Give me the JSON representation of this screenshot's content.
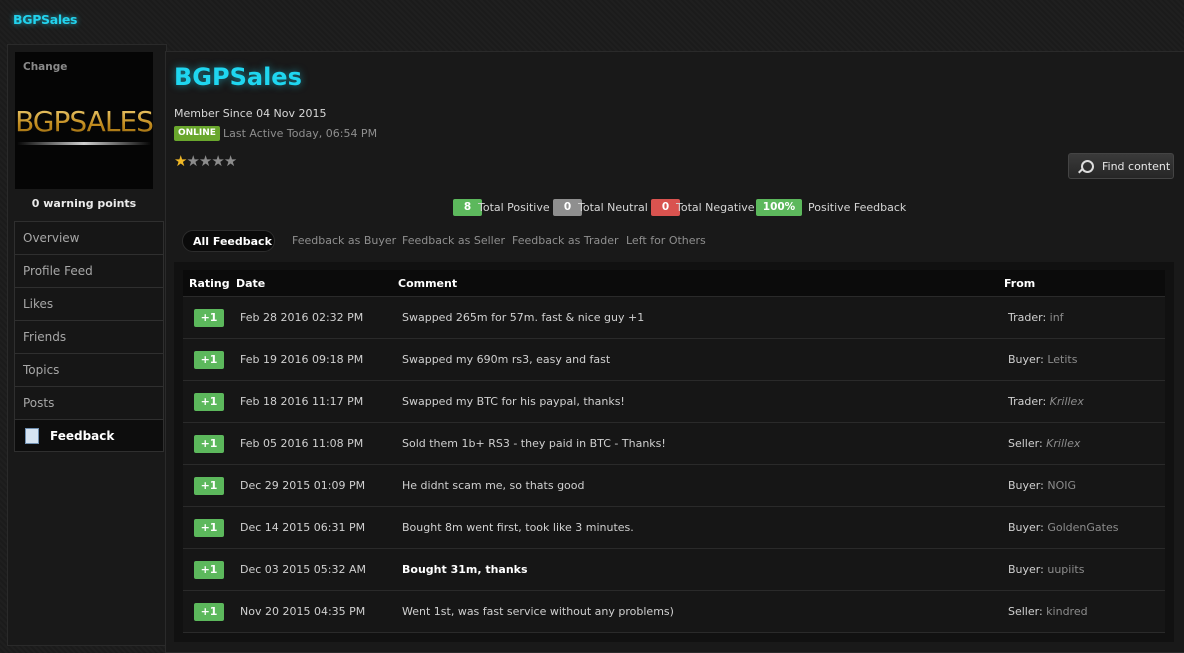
{
  "site": {
    "title": "BGPSales"
  },
  "profile": {
    "avatar_change": "Change",
    "avatar_logo": "BGPSALES",
    "warning_points": "0 warning points",
    "name": "BGPSales",
    "member_since": "Member Since 04 Nov 2015",
    "status": "ONLINE",
    "last_active": "Last Active Today, 06:54 PM",
    "rating_stars": 1,
    "rating_max": 5,
    "find_content": "Find content"
  },
  "sidebar": {
    "items": [
      {
        "label": "Overview"
      },
      {
        "label": "Profile Feed"
      },
      {
        "label": "Likes"
      },
      {
        "label": "Friends"
      },
      {
        "label": "Topics"
      },
      {
        "label": "Posts"
      },
      {
        "label": "Feedback",
        "active": true
      }
    ]
  },
  "totals": {
    "positive_count": "8",
    "positive_label": "Total Positive",
    "positive_color": "#5cb85c",
    "neutral_count": "0",
    "neutral_label": "Total Neutral",
    "neutral_color": "#8f8f8f",
    "negative_count": "0",
    "negative_label": "Total Negative",
    "negative_color": "#d9534f",
    "feedback_pct": "100%",
    "feedback_label": "Positive Feedback",
    "feedback_color": "#5cb85c"
  },
  "tabs": [
    {
      "label": "All Feedback",
      "active": true
    },
    {
      "label": "Feedback as Buyer"
    },
    {
      "label": "Feedback as Seller"
    },
    {
      "label": "Feedback as Trader"
    },
    {
      "label": "Left for Others"
    }
  ],
  "table": {
    "headers": {
      "rating": "Rating",
      "date": "Date",
      "comment": "Comment",
      "from": "From"
    },
    "rows": [
      {
        "rating": "+1",
        "date": "Feb 28 2016 02:32 PM",
        "comment": "Swapped 265m for 57m. fast & nice guy +1",
        "role": "Trader:",
        "user": "inf"
      },
      {
        "rating": "+1",
        "date": "Feb 19 2016 09:18 PM",
        "comment": "Swapped my 690m rs3, easy and fast",
        "role": "Buyer:",
        "user": "Letits"
      },
      {
        "rating": "+1",
        "date": "Feb 18 2016 11:17 PM",
        "comment": "Swapped my BTC for his paypal, thanks!",
        "role": "Trader:",
        "user": "Krillex"
      },
      {
        "rating": "+1",
        "date": "Feb 05 2016 11:08 PM",
        "comment": "Sold them 1b+ RS3 - they paid in BTC - Thanks!",
        "role": "Seller:",
        "user": "Krillex"
      },
      {
        "rating": "+1",
        "date": "Dec 29 2015 01:09 PM",
        "comment": "He didnt scam me, so thats good",
        "role": "Buyer:",
        "user": "NOIG"
      },
      {
        "rating": "+1",
        "date": "Dec 14 2015 06:31 PM",
        "comment": "Bought 8m went first, took like 3 minutes.",
        "role": "Buyer:",
        "user": "GoldenGates"
      },
      {
        "rating": "+1",
        "date": "Dec 03 2015 05:32 AM",
        "comment": "Bought 31m, thanks",
        "role": "Buyer:",
        "user": "uupiits"
      },
      {
        "rating": "+1",
        "date": "Nov 20 2015 04:35 PM",
        "comment": "Went 1st, was fast service without any problems)",
        "role": "Seller:",
        "user": "kindred"
      }
    ]
  }
}
